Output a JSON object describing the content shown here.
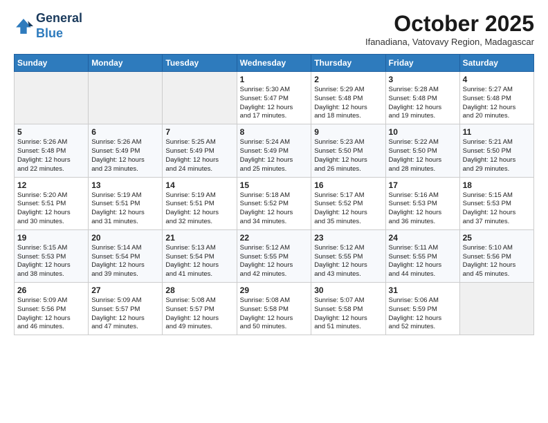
{
  "logo": {
    "line1": "General",
    "line2": "Blue"
  },
  "title": "October 2025",
  "subtitle": "Ifanadiana, Vatovavy Region, Madagascar",
  "days_of_week": [
    "Sunday",
    "Monday",
    "Tuesday",
    "Wednesday",
    "Thursday",
    "Friday",
    "Saturday"
  ],
  "weeks": [
    [
      {
        "day": "",
        "content": ""
      },
      {
        "day": "",
        "content": ""
      },
      {
        "day": "",
        "content": ""
      },
      {
        "day": "1",
        "content": "Sunrise: 5:30 AM\nSunset: 5:47 PM\nDaylight: 12 hours\nand 17 minutes."
      },
      {
        "day": "2",
        "content": "Sunrise: 5:29 AM\nSunset: 5:48 PM\nDaylight: 12 hours\nand 18 minutes."
      },
      {
        "day": "3",
        "content": "Sunrise: 5:28 AM\nSunset: 5:48 PM\nDaylight: 12 hours\nand 19 minutes."
      },
      {
        "day": "4",
        "content": "Sunrise: 5:27 AM\nSunset: 5:48 PM\nDaylight: 12 hours\nand 20 minutes."
      }
    ],
    [
      {
        "day": "5",
        "content": "Sunrise: 5:26 AM\nSunset: 5:48 PM\nDaylight: 12 hours\nand 22 minutes."
      },
      {
        "day": "6",
        "content": "Sunrise: 5:26 AM\nSunset: 5:49 PM\nDaylight: 12 hours\nand 23 minutes."
      },
      {
        "day": "7",
        "content": "Sunrise: 5:25 AM\nSunset: 5:49 PM\nDaylight: 12 hours\nand 24 minutes."
      },
      {
        "day": "8",
        "content": "Sunrise: 5:24 AM\nSunset: 5:49 PM\nDaylight: 12 hours\nand 25 minutes."
      },
      {
        "day": "9",
        "content": "Sunrise: 5:23 AM\nSunset: 5:50 PM\nDaylight: 12 hours\nand 26 minutes."
      },
      {
        "day": "10",
        "content": "Sunrise: 5:22 AM\nSunset: 5:50 PM\nDaylight: 12 hours\nand 28 minutes."
      },
      {
        "day": "11",
        "content": "Sunrise: 5:21 AM\nSunset: 5:50 PM\nDaylight: 12 hours\nand 29 minutes."
      }
    ],
    [
      {
        "day": "12",
        "content": "Sunrise: 5:20 AM\nSunset: 5:51 PM\nDaylight: 12 hours\nand 30 minutes."
      },
      {
        "day": "13",
        "content": "Sunrise: 5:19 AM\nSunset: 5:51 PM\nDaylight: 12 hours\nand 31 minutes."
      },
      {
        "day": "14",
        "content": "Sunrise: 5:19 AM\nSunset: 5:51 PM\nDaylight: 12 hours\nand 32 minutes."
      },
      {
        "day": "15",
        "content": "Sunrise: 5:18 AM\nSunset: 5:52 PM\nDaylight: 12 hours\nand 34 minutes."
      },
      {
        "day": "16",
        "content": "Sunrise: 5:17 AM\nSunset: 5:52 PM\nDaylight: 12 hours\nand 35 minutes."
      },
      {
        "day": "17",
        "content": "Sunrise: 5:16 AM\nSunset: 5:53 PM\nDaylight: 12 hours\nand 36 minutes."
      },
      {
        "day": "18",
        "content": "Sunrise: 5:15 AM\nSunset: 5:53 PM\nDaylight: 12 hours\nand 37 minutes."
      }
    ],
    [
      {
        "day": "19",
        "content": "Sunrise: 5:15 AM\nSunset: 5:53 PM\nDaylight: 12 hours\nand 38 minutes."
      },
      {
        "day": "20",
        "content": "Sunrise: 5:14 AM\nSunset: 5:54 PM\nDaylight: 12 hours\nand 39 minutes."
      },
      {
        "day": "21",
        "content": "Sunrise: 5:13 AM\nSunset: 5:54 PM\nDaylight: 12 hours\nand 41 minutes."
      },
      {
        "day": "22",
        "content": "Sunrise: 5:12 AM\nSunset: 5:55 PM\nDaylight: 12 hours\nand 42 minutes."
      },
      {
        "day": "23",
        "content": "Sunrise: 5:12 AM\nSunset: 5:55 PM\nDaylight: 12 hours\nand 43 minutes."
      },
      {
        "day": "24",
        "content": "Sunrise: 5:11 AM\nSunset: 5:55 PM\nDaylight: 12 hours\nand 44 minutes."
      },
      {
        "day": "25",
        "content": "Sunrise: 5:10 AM\nSunset: 5:56 PM\nDaylight: 12 hours\nand 45 minutes."
      }
    ],
    [
      {
        "day": "26",
        "content": "Sunrise: 5:09 AM\nSunset: 5:56 PM\nDaylight: 12 hours\nand 46 minutes."
      },
      {
        "day": "27",
        "content": "Sunrise: 5:09 AM\nSunset: 5:57 PM\nDaylight: 12 hours\nand 47 minutes."
      },
      {
        "day": "28",
        "content": "Sunrise: 5:08 AM\nSunset: 5:57 PM\nDaylight: 12 hours\nand 49 minutes."
      },
      {
        "day": "29",
        "content": "Sunrise: 5:08 AM\nSunset: 5:58 PM\nDaylight: 12 hours\nand 50 minutes."
      },
      {
        "day": "30",
        "content": "Sunrise: 5:07 AM\nSunset: 5:58 PM\nDaylight: 12 hours\nand 51 minutes."
      },
      {
        "day": "31",
        "content": "Sunrise: 5:06 AM\nSunset: 5:59 PM\nDaylight: 12 hours\nand 52 minutes."
      },
      {
        "day": "",
        "content": ""
      }
    ]
  ]
}
